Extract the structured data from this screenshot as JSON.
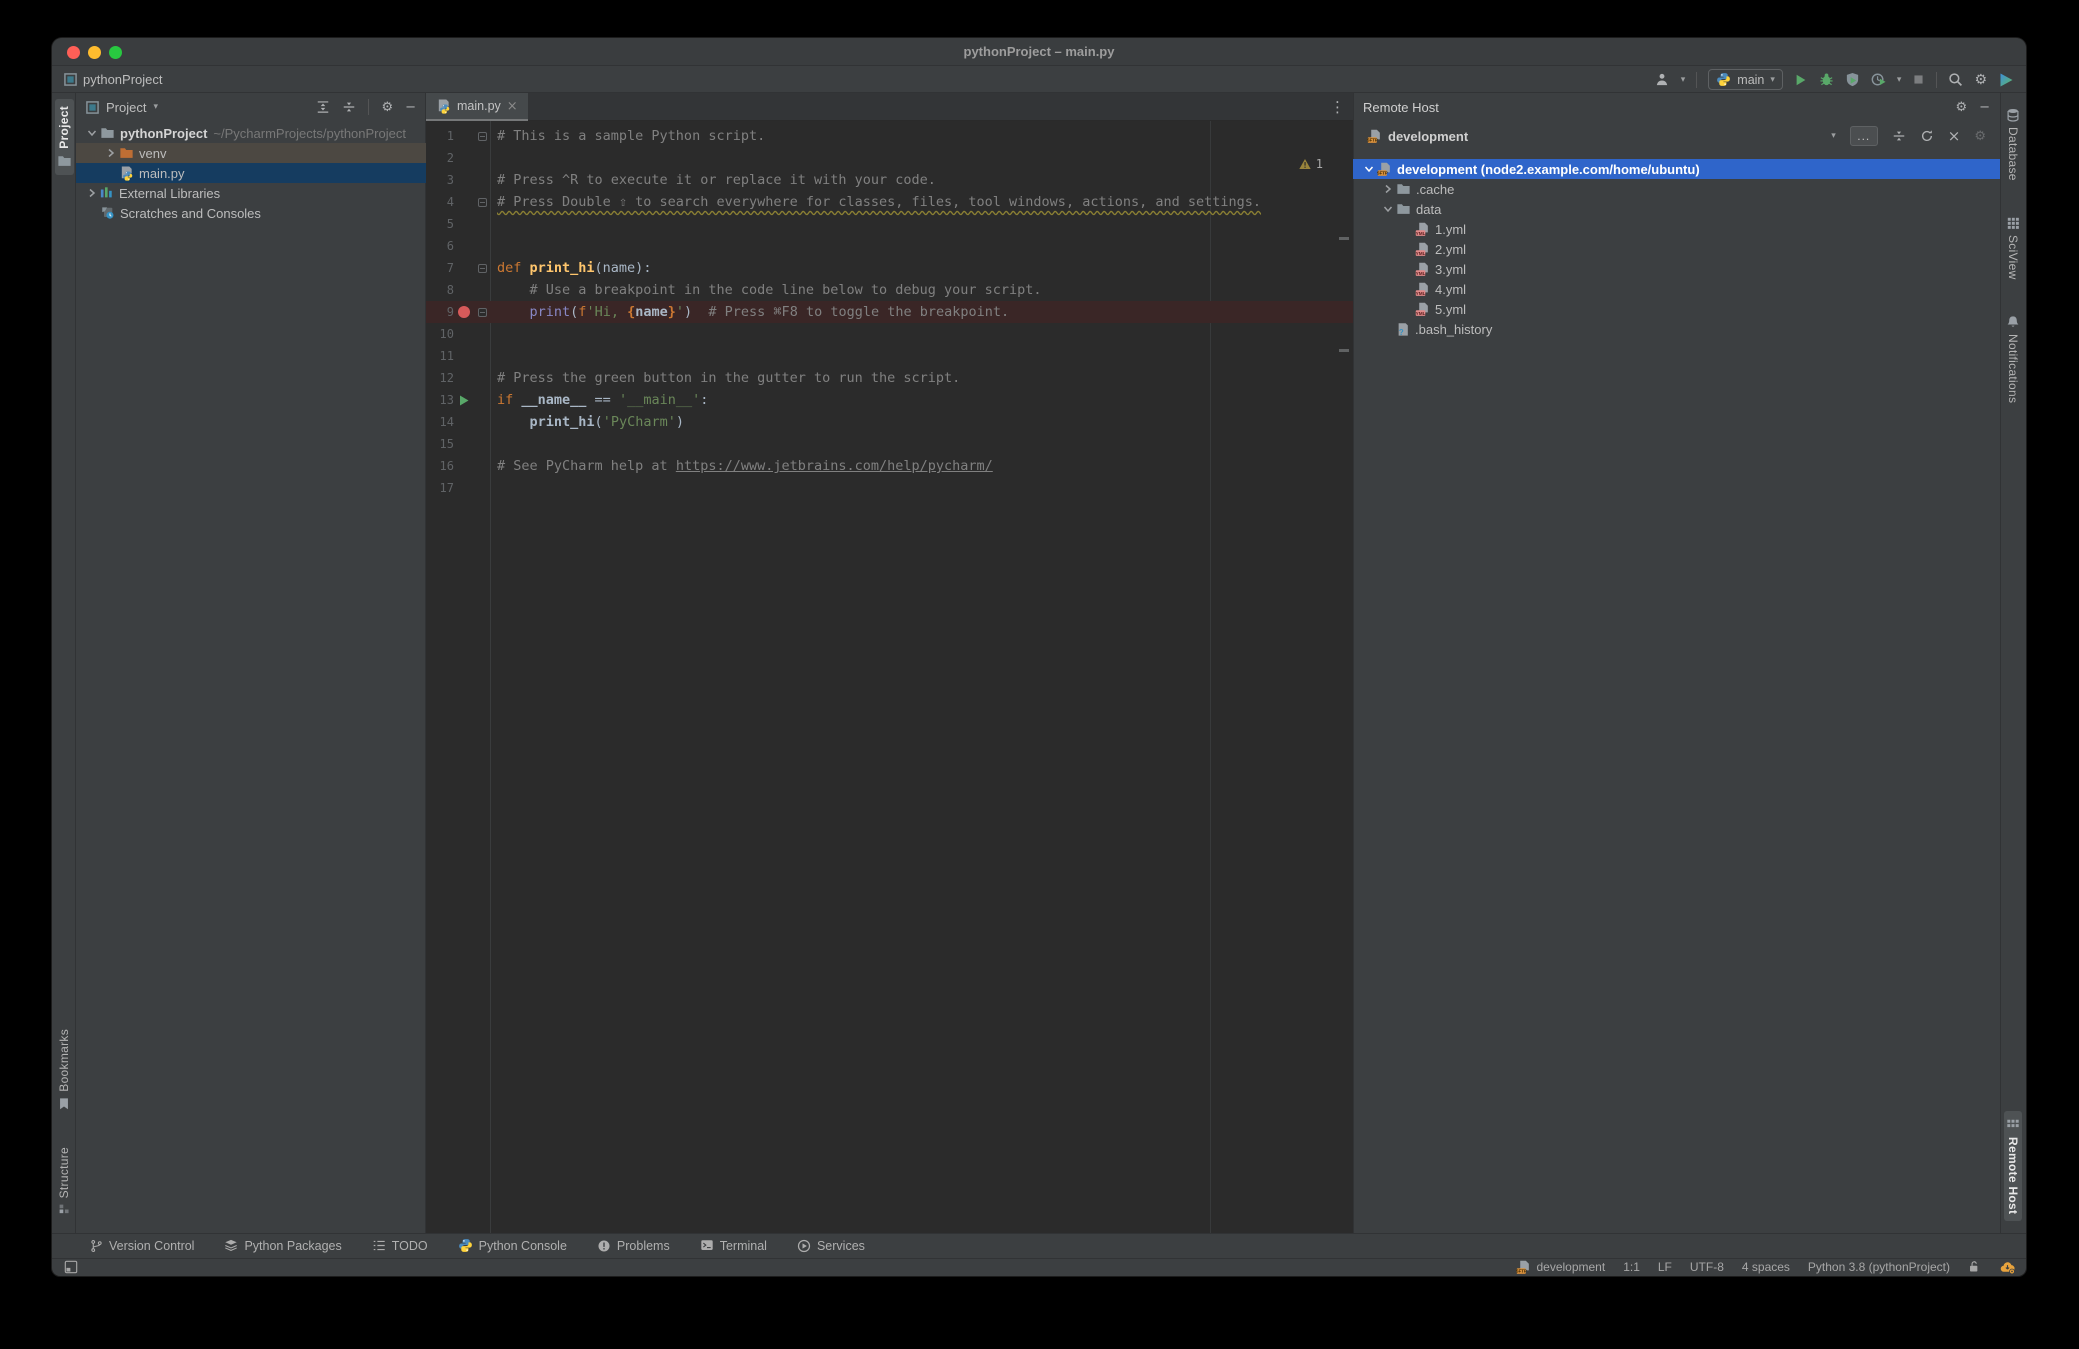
{
  "window": {
    "title": "pythonProject – main.py",
    "project_badge": "pythonProject"
  },
  "toolbar": {
    "run_config_label": "main"
  },
  "left_stripe": {
    "project_label": "Project",
    "bookmarks_label": "Bookmarks",
    "structure_label": "Structure"
  },
  "project_panel": {
    "title": "Project",
    "tree": [
      {
        "label": "pythonProject",
        "suffix": "~/PycharmProjects/pythonProject",
        "icon": "folder",
        "level": 0,
        "expander": "open",
        "bold": true
      },
      {
        "label": "venv",
        "icon": "folder-venv",
        "level": 1,
        "expander": "closed",
        "row": "hover"
      },
      {
        "label": "main.py",
        "icon": "python-file",
        "level": 1,
        "expander": "none",
        "row": "selected-dim"
      },
      {
        "label": "External Libraries",
        "icon": "libraries",
        "level": 0,
        "expander": "closed"
      },
      {
        "label": "Scratches and Consoles",
        "icon": "scratches",
        "level": 0,
        "expander": "none"
      }
    ]
  },
  "editor": {
    "tab_label": "main.py",
    "warning_count": "1",
    "lines": [
      {
        "n": "1",
        "fold": true,
        "seg": [
          [
            "comment",
            "# This is a sample Python script."
          ]
        ]
      },
      {
        "n": "2",
        "seg": []
      },
      {
        "n": "3",
        "seg": [
          [
            "comment",
            "# Press ^R to execute it or replace it with your code."
          ]
        ]
      },
      {
        "n": "4",
        "fold": true,
        "seg": [
          [
            "commentw",
            "# Press Double ⇧ to search everywhere for classes, files, tool windows, actions, and settings."
          ]
        ]
      },
      {
        "n": "5",
        "seg": []
      },
      {
        "n": "6",
        "seg": []
      },
      {
        "n": "7",
        "fold": true,
        "seg": [
          [
            "kw",
            "def "
          ],
          [
            "fn",
            "print_hi"
          ],
          [
            "plain",
            "(name):"
          ]
        ]
      },
      {
        "n": "8",
        "seg": [
          [
            "plain",
            "    "
          ],
          [
            "comment",
            "# Use a breakpoint in the code line below to debug your script."
          ]
        ]
      },
      {
        "n": "9",
        "fold": true,
        "mark": "breakpoint",
        "hl": true,
        "seg": [
          [
            "plain",
            "    "
          ],
          [
            "builtin",
            "print"
          ],
          [
            "plain",
            "("
          ],
          [
            "kw",
            "f"
          ],
          [
            "str",
            "'Hi, "
          ],
          [
            "brace",
            "{"
          ],
          [
            "bold",
            "name"
          ],
          [
            "brace",
            "}"
          ],
          [
            "str",
            "'"
          ],
          [
            "plain",
            ")"
          ],
          [
            "comment",
            "  # Press ⌘F8 to toggle the breakpoint."
          ]
        ]
      },
      {
        "n": "10",
        "seg": []
      },
      {
        "n": "11",
        "seg": []
      },
      {
        "n": "12",
        "seg": [
          [
            "comment",
            "# Press the green button in the gutter to run the script."
          ]
        ]
      },
      {
        "n": "13",
        "mark": "run",
        "seg": [
          [
            "kw",
            "if "
          ],
          [
            "bold",
            "__name__"
          ],
          [
            "plain",
            " == "
          ],
          [
            "str",
            "'__main__'"
          ],
          [
            "plain",
            ":"
          ]
        ]
      },
      {
        "n": "14",
        "seg": [
          [
            "plain",
            "    "
          ],
          [
            "bold",
            "print_hi"
          ],
          [
            "plain",
            "("
          ],
          [
            "str",
            "'PyCharm'"
          ],
          [
            "plain",
            ")"
          ]
        ]
      },
      {
        "n": "15",
        "seg": []
      },
      {
        "n": "16",
        "seg": [
          [
            "comment",
            "# See PyCharm help at "
          ],
          [
            "url",
            "https://www.jetbrains.com/help/pycharm/"
          ]
        ]
      },
      {
        "n": "17",
        "seg": []
      }
    ]
  },
  "remote_panel": {
    "title": "Remote Host",
    "combo_label": "development",
    "more_button": "...",
    "tree": [
      {
        "label": "development (node2.example.com/home/ubuntu)",
        "icon": "sftp",
        "level": 0,
        "expander": "open",
        "row": "selected-focus",
        "bold": true
      },
      {
        "label": ".cache",
        "icon": "folder",
        "level": 1,
        "expander": "closed"
      },
      {
        "label": "data",
        "icon": "folder",
        "level": 1,
        "expander": "open"
      },
      {
        "label": "1.yml",
        "icon": "yml",
        "level": 2,
        "expander": "none"
      },
      {
        "label": "2.yml",
        "icon": "yml",
        "level": 2,
        "expander": "none"
      },
      {
        "label": "3.yml",
        "icon": "yml",
        "level": 2,
        "expander": "none"
      },
      {
        "label": "4.yml",
        "icon": "yml",
        "level": 2,
        "expander": "none"
      },
      {
        "label": "5.yml",
        "icon": "yml",
        "level": 2,
        "expander": "none"
      },
      {
        "label": ".bash_history",
        "icon": "file-unknown",
        "level": 1,
        "expander": "none"
      }
    ]
  },
  "right_stripe": {
    "top": [
      {
        "label": "Database",
        "icon": "database"
      },
      {
        "label": "SciView",
        "icon": "grid"
      },
      {
        "label": "Notifications",
        "icon": "bell"
      }
    ],
    "bottom": [
      {
        "label": "Remote Host",
        "icon": "remote-host",
        "active": true
      }
    ]
  },
  "bottom_bar": {
    "items": [
      {
        "label": "Version Control",
        "icon": "branch"
      },
      {
        "label": "Python Packages",
        "icon": "layers"
      },
      {
        "label": "TODO",
        "icon": "todo"
      },
      {
        "label": "Python Console",
        "icon": "python"
      },
      {
        "label": "Problems",
        "icon": "problems"
      },
      {
        "label": "Terminal",
        "icon": "terminal"
      },
      {
        "label": "Services",
        "icon": "services"
      }
    ]
  },
  "status_bar": {
    "host": "development",
    "caret": "1:1",
    "line_sep": "LF",
    "encoding": "UTF-8",
    "indent": "4 spaces",
    "interpreter": "Python 3.8 (pythonProject)"
  },
  "colors": {
    "selection_focus": "#2f65ca",
    "selection_dim": "#153c60",
    "run_green": "#59a869",
    "breakpoint_red": "#d75a5a",
    "editor_bg": "#2b2b2b",
    "chrome_bg": "#3c3f41"
  }
}
